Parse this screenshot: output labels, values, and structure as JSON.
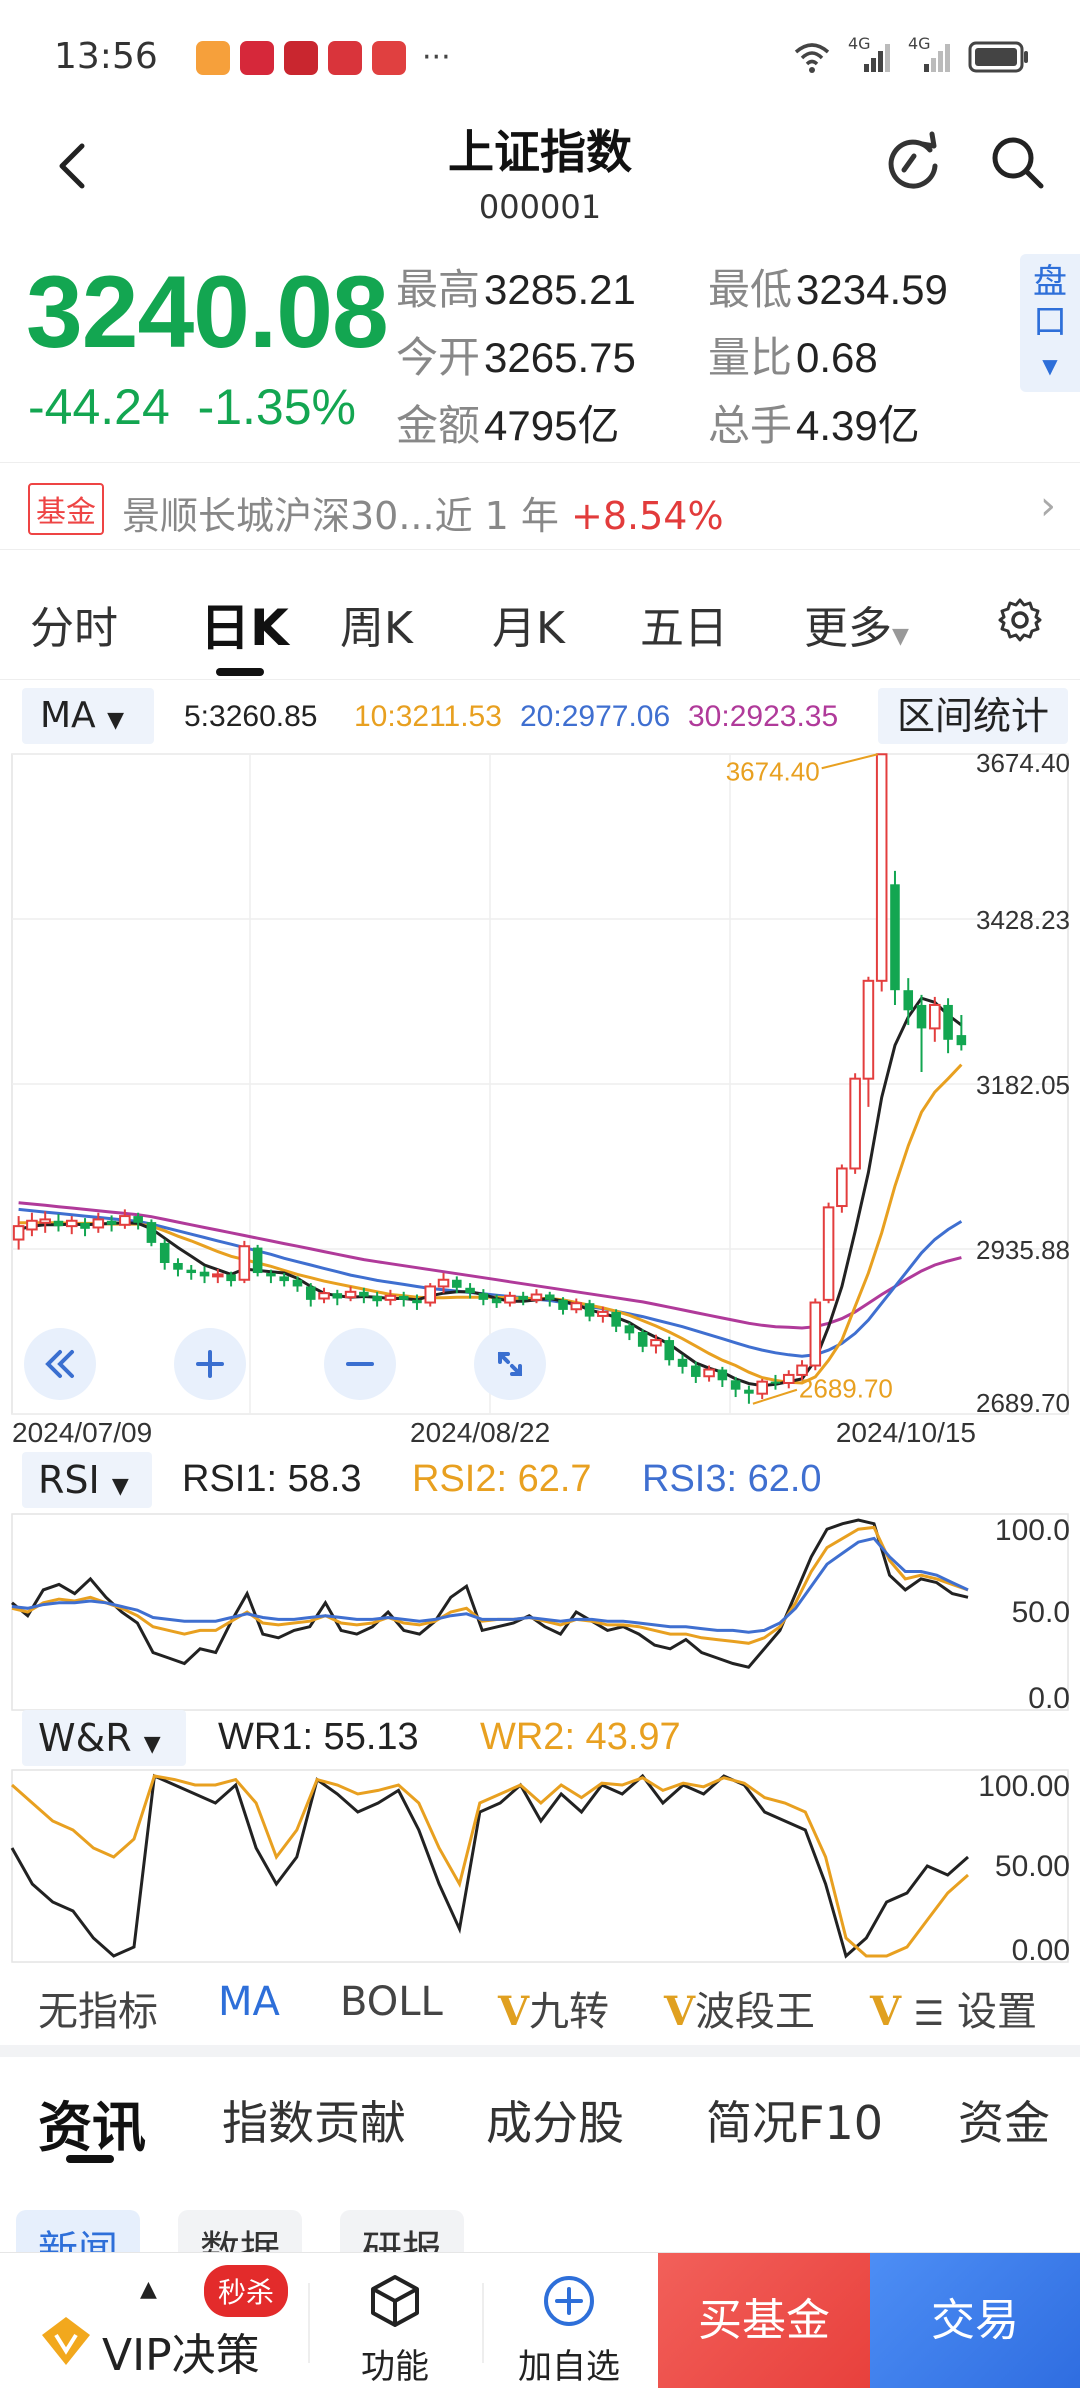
{
  "status": {
    "time": "13:56",
    "apps": [
      "#f6a03b",
      "#d6283a",
      "#c9262f",
      "#d9343b",
      "#e04040"
    ],
    "signal1": "4G",
    "signal2": "4G"
  },
  "nav": {
    "title": "上证指数",
    "code": "000001"
  },
  "quote": {
    "price": "3240.08",
    "change": "-44.24",
    "change_pct": "-1.35%",
    "stats": [
      {
        "label": "最高",
        "value": "3285.21"
      },
      {
        "label": "最低",
        "value": "3234.59"
      },
      {
        "label": "今开",
        "value": "3265.75"
      },
      {
        "label": "量比",
        "value": "0.68"
      },
      {
        "label": "金额",
        "value": "4795亿"
      },
      {
        "label": "总手",
        "value": "4.39亿"
      }
    ],
    "pankou": "盘口"
  },
  "fund_banner": {
    "tag": "基金",
    "text": "景顺长城沪深30...近 1 年 ",
    "gain": "+8.54%"
  },
  "period_tabs": [
    "分时",
    "日K",
    "周K",
    "月K",
    "五日",
    "更多"
  ],
  "ma": {
    "label": "MA",
    "ma5": "5:3260.85",
    "ma10": "10:3211.53",
    "ma20": "20:2977.06",
    "ma30": "30:2923.35",
    "range_label": "区间统计",
    "colors": {
      "ma5": "#222222",
      "ma10": "#e8a020",
      "ma20": "#3f6fd0",
      "ma30": "#b03a9a"
    }
  },
  "chart_data": [
    {
      "type": "candlestick",
      "y_ticks": [
        "3674.40",
        "3428.23",
        "3182.05",
        "2935.88",
        "2689.70"
      ],
      "ylim": [
        2689.7,
        3674.4
      ],
      "x_labels": [
        "2024/07/09",
        "2024/08/22",
        "2024/10/15"
      ],
      "high_label": "3674.40",
      "low_label": "2689.70",
      "candles": [
        [
          2950,
          2970,
          2935,
          2985
        ],
        [
          2965,
          2978,
          2955,
          2990
        ],
        [
          2975,
          2980,
          2960,
          2992
        ],
        [
          2978,
          2970,
          2962,
          2988
        ],
        [
          2970,
          2978,
          2958,
          2985
        ],
        [
          2975,
          2966,
          2955,
          2982
        ],
        [
          2968,
          2980,
          2960,
          2990
        ],
        [
          2978,
          2972,
          2962,
          2986
        ],
        [
          2972,
          2985,
          2966,
          2995
        ],
        [
          2985,
          2975,
          2965,
          2990
        ],
        [
          2976,
          2945,
          2940,
          2980
        ],
        [
          2945,
          2915,
          2905,
          2950
        ],
        [
          2915,
          2905,
          2895,
          2922
        ],
        [
          2905,
          2900,
          2890,
          2912
        ],
        [
          2902,
          2895,
          2885,
          2910
        ],
        [
          2896,
          2898,
          2885,
          2906
        ],
        [
          2898,
          2888,
          2880,
          2902
        ],
        [
          2890,
          2940,
          2885,
          2948
        ],
        [
          2938,
          2900,
          2895,
          2942
        ],
        [
          2900,
          2895,
          2885,
          2905
        ],
        [
          2895,
          2888,
          2880,
          2900
        ],
        [
          2890,
          2880,
          2872,
          2895
        ],
        [
          2880,
          2860,
          2850,
          2885
        ],
        [
          2862,
          2870,
          2855,
          2878
        ],
        [
          2870,
          2862,
          2852,
          2875
        ],
        [
          2864,
          2872,
          2858,
          2880
        ],
        [
          2872,
          2865,
          2855,
          2878
        ],
        [
          2866,
          2858,
          2850,
          2872
        ],
        [
          2860,
          2866,
          2852,
          2875
        ],
        [
          2866,
          2860,
          2850,
          2872
        ],
        [
          2860,
          2855,
          2845,
          2868
        ],
        [
          2856,
          2880,
          2850,
          2885
        ],
        [
          2880,
          2890,
          2870,
          2900
        ],
        [
          2890,
          2878,
          2870,
          2895
        ],
        [
          2878,
          2870,
          2862,
          2885
        ],
        [
          2870,
          2860,
          2852,
          2876
        ],
        [
          2862,
          2855,
          2848,
          2868
        ],
        [
          2856,
          2866,
          2850,
          2872
        ],
        [
          2866,
          2860,
          2852,
          2872
        ],
        [
          2860,
          2868,
          2855,
          2876
        ],
        [
          2868,
          2860,
          2850,
          2872
        ],
        [
          2860,
          2845,
          2838,
          2864
        ],
        [
          2846,
          2855,
          2840,
          2862
        ],
        [
          2855,
          2835,
          2828,
          2860
        ],
        [
          2836,
          2842,
          2826,
          2850
        ],
        [
          2842,
          2820,
          2812,
          2846
        ],
        [
          2822,
          2810,
          2800,
          2826
        ],
        [
          2812,
          2790,
          2782,
          2816
        ],
        [
          2792,
          2800,
          2780,
          2808
        ],
        [
          2800,
          2770,
          2762,
          2805
        ],
        [
          2772,
          2760,
          2750,
          2778
        ],
        [
          2762,
          2745,
          2736,
          2768
        ],
        [
          2746,
          2756,
          2738,
          2762
        ],
        [
          2756,
          2740,
          2730,
          2760
        ],
        [
          2740,
          2726,
          2715,
          2745
        ],
        [
          2726,
          2720,
          2705,
          2732
        ],
        [
          2720,
          2738,
          2712,
          2742
        ],
        [
          2738,
          2735,
          2726,
          2748
        ],
        [
          2736,
          2748,
          2728,
          2755
        ],
        [
          2748,
          2762,
          2740,
          2770
        ],
        [
          2762,
          2856,
          2755,
          2862
        ],
        [
          2860,
          2998,
          2855,
          3005
        ],
        [
          3000,
          3056,
          2990,
          3062
        ],
        [
          3056,
          3190,
          3048,
          3198
        ],
        [
          3190,
          3336,
          3148,
          3342
        ],
        [
          3336,
          3674,
          3320,
          3674
        ],
        [
          3480,
          3322,
          3300,
          3500
        ],
        [
          3322,
          3292,
          3270,
          3340
        ],
        [
          3300,
          3265,
          3200,
          3315
        ],
        [
          3265,
          3300,
          3245,
          3312
        ],
        [
          3300,
          3248,
          3228,
          3310
        ],
        [
          3255,
          3240,
          3232,
          3285
        ]
      ],
      "ma5": [
        2965,
        2970,
        2972,
        2972,
        2973,
        2972,
        2973,
        2974,
        2975,
        2974,
        2966,
        2952,
        2938,
        2925,
        2912,
        2905,
        2898,
        2906,
        2904,
        2902,
        2900,
        2892,
        2880,
        2870,
        2866,
        2864,
        2865,
        2864,
        2862,
        2862,
        2860,
        2866,
        2870,
        2872,
        2872,
        2868,
        2862,
        2858,
        2858,
        2860,
        2862,
        2858,
        2853,
        2845,
        2840,
        2834,
        2826,
        2814,
        2804,
        2794,
        2780,
        2766,
        2758,
        2752,
        2742,
        2735,
        2732,
        2734,
        2738,
        2742,
        2770,
        2820,
        2880,
        2962,
        3050,
        3162,
        3240,
        3282,
        3310,
        3304,
        3285,
        3270
      ],
      "ma10": [
        2975,
        2975,
        2975,
        2975,
        2974,
        2974,
        2974,
        2973,
        2973,
        2973,
        2970,
        2963,
        2955,
        2948,
        2940,
        2932,
        2925,
        2920,
        2915,
        2910,
        2904,
        2898,
        2893,
        2888,
        2884,
        2880,
        2876,
        2872,
        2868,
        2866,
        2864,
        2863,
        2863,
        2864,
        2864,
        2864,
        2864,
        2863,
        2862,
        2862,
        2862,
        2860,
        2856,
        2852,
        2848,
        2843,
        2837,
        2829,
        2821,
        2812,
        2802,
        2791,
        2780,
        2770,
        2762,
        2752,
        2744,
        2740,
        2737,
        2736,
        2745,
        2770,
        2800,
        2850,
        2900,
        2960,
        3030,
        3090,
        3140,
        3170,
        3190,
        3211
      ],
      "ma20": [
        2995,
        2993,
        2991,
        2989,
        2987,
        2985,
        2983,
        2981,
        2979,
        2977,
        2973,
        2968,
        2963,
        2958,
        2953,
        2948,
        2943,
        2938,
        2933,
        2928,
        2922,
        2917,
        2912,
        2907,
        2902,
        2897,
        2893,
        2889,
        2886,
        2883,
        2880,
        2877,
        2875,
        2873,
        2871,
        2869,
        2867,
        2865,
        2863,
        2861,
        2859,
        2856,
        2853,
        2850,
        2847,
        2843,
        2839,
        2835,
        2830,
        2825,
        2820,
        2814,
        2808,
        2802,
        2796,
        2790,
        2785,
        2781,
        2778,
        2776,
        2778,
        2785,
        2795,
        2810,
        2830,
        2855,
        2880,
        2905,
        2930,
        2950,
        2965,
        2977
      ],
      "ma30": [
        3005,
        3003,
        3001,
        2999,
        2997,
        2995,
        2993,
        2991,
        2989,
        2987,
        2984,
        2980,
        2976,
        2972,
        2968,
        2964,
        2960,
        2956,
        2952,
        2948,
        2944,
        2940,
        2936,
        2932,
        2928,
        2924,
        2920,
        2917,
        2914,
        2911,
        2908,
        2905,
        2902,
        2899,
        2896,
        2893,
        2890,
        2887,
        2884,
        2881,
        2878,
        2875,
        2872,
        2869,
        2866,
        2863,
        2860,
        2857,
        2853,
        2849,
        2845,
        2841,
        2837,
        2833,
        2829,
        2825,
        2822,
        2820,
        2819,
        2818,
        2820,
        2825,
        2832,
        2842,
        2855,
        2868,
        2880,
        2892,
        2903,
        2912,
        2918,
        2923
      ]
    },
    {
      "type": "line",
      "name": "RSI",
      "label": "RSI",
      "rsi1_label": "RSI1: 58.3",
      "rsi2_label": "RSI2: 62.7",
      "rsi3_label": "RSI3: 62.0",
      "y_ticks": [
        "100.0",
        "50.0",
        "0.0"
      ],
      "ylim": [
        0,
        100
      ],
      "series": [
        {
          "name": "RSI1",
          "color": "#222222",
          "values": [
            55,
            48,
            62,
            65,
            60,
            68,
            58,
            50,
            44,
            28,
            25,
            22,
            30,
            28,
            45,
            60,
            38,
            36,
            40,
            42,
            55,
            40,
            38,
            42,
            50,
            40,
            38,
            45,
            58,
            64,
            40,
            42,
            44,
            48,
            42,
            38,
            50,
            45,
            40,
            42,
            38,
            32,
            30,
            35,
            28,
            25,
            22,
            20,
            30,
            40,
            60,
            80,
            95,
            98,
            100,
            98,
            70,
            62,
            68,
            66,
            60,
            58
          ]
        },
        {
          "name": "RSI2",
          "color": "#e8a020",
          "values": [
            52,
            50,
            55,
            57,
            56,
            58,
            55,
            52,
            48,
            42,
            40,
            38,
            40,
            40,
            45,
            50,
            44,
            43,
            44,
            45,
            48,
            44,
            43,
            44,
            47,
            44,
            43,
            45,
            50,
            52,
            45,
            46,
            46,
            47,
            45,
            43,
            46,
            45,
            43,
            43,
            42,
            40,
            38,
            38,
            36,
            35,
            34,
            33,
            36,
            42,
            55,
            72,
            85,
            90,
            95,
            96,
            78,
            68,
            70,
            68,
            65,
            62
          ]
        },
        {
          "name": "RSI3",
          "color": "#3f6fd0",
          "values": [
            53,
            52,
            54,
            55,
            55,
            56,
            55,
            53,
            51,
            47,
            46,
            45,
            45,
            45,
            47,
            49,
            47,
            46,
            46,
            47,
            48,
            47,
            46,
            46,
            47,
            46,
            45,
            46,
            48,
            49,
            46,
            46,
            46,
            47,
            46,
            45,
            46,
            46,
            45,
            45,
            44,
            43,
            42,
            42,
            41,
            40,
            40,
            39,
            40,
            44,
            52,
            64,
            76,
            82,
            88,
            90,
            80,
            72,
            72,
            70,
            66,
            62
          ]
        }
      ]
    },
    {
      "type": "line",
      "name": "W&R",
      "label": "W&R",
      "wr1_label": "WR1: 55.13",
      "wr2_label": "WR2: 43.97",
      "y_ticks": [
        "100.00",
        "50.00",
        "0.00"
      ],
      "ylim": [
        0,
        100
      ],
      "series": [
        {
          "name": "WR1",
          "color": "#222222",
          "values": [
            60,
            40,
            30,
            25,
            10,
            0,
            5,
            100,
            95,
            90,
            85,
            95,
            60,
            40,
            55,
            98,
            90,
            80,
            85,
            92,
            70,
            40,
            15,
            80,
            85,
            95,
            75,
            90,
            80,
            95,
            90,
            100,
            85,
            95,
            90,
            100,
            95,
            80,
            75,
            70,
            40,
            0,
            10,
            30,
            35,
            50,
            45,
            55
          ]
        },
        {
          "name": "WR2",
          "color": "#e8a020",
          "values": [
            95,
            85,
            75,
            70,
            60,
            55,
            65,
            100,
            98,
            95,
            95,
            98,
            85,
            55,
            70,
            98,
            95,
            90,
            92,
            95,
            85,
            60,
            40,
            85,
            90,
            95,
            85,
            95,
            88,
            96,
            95,
            99,
            92,
            96,
            94,
            99,
            96,
            88,
            85,
            80,
            55,
            10,
            0,
            0,
            5,
            20,
            35,
            45
          ]
        }
      ]
    }
  ],
  "indicator_tabs": [
    "无指标",
    "MA",
    "BOLL",
    "九转",
    "波段王",
    "设置"
  ],
  "info_tabs": [
    "资讯",
    "指数贡献",
    "成分股",
    "简况F10",
    "资金"
  ],
  "sub_tabs": [
    "新闻",
    "数据",
    "研报"
  ],
  "bottom": {
    "badge": "秒杀",
    "vip": "VIP决策",
    "func": "功能",
    "add": "加自选",
    "buy_fund": "买基金",
    "trade": "交易"
  }
}
